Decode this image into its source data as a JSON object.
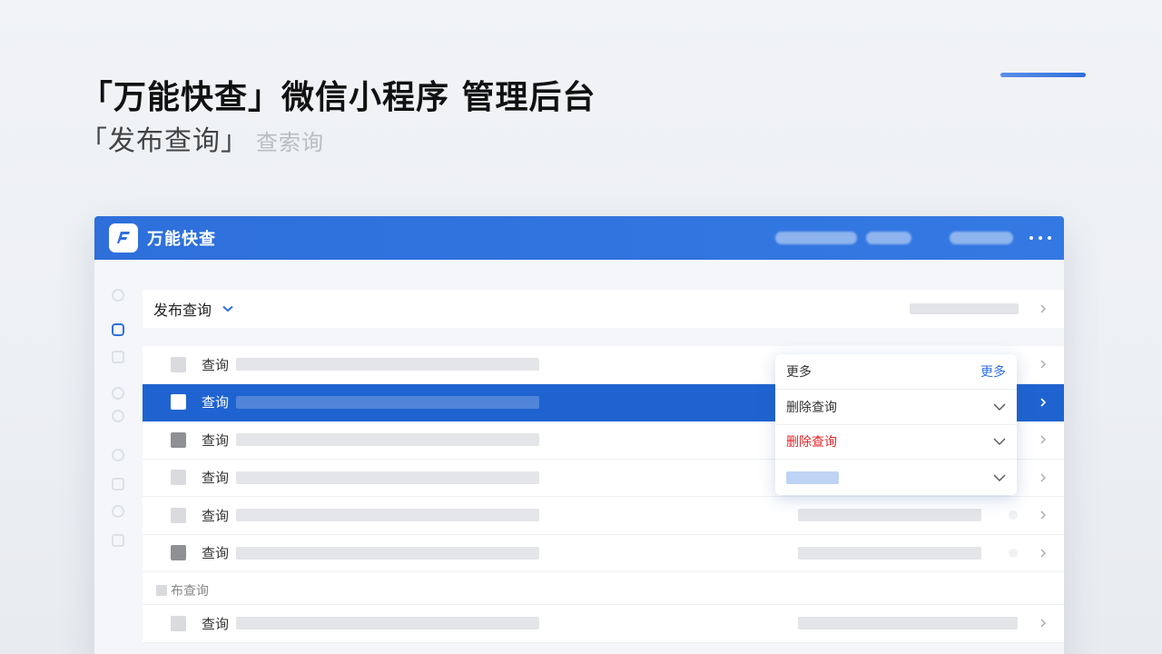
{
  "page": {
    "title": "「万能快查」微信小程序 管理后台",
    "subtitle": "「发布查询」",
    "subtitle_faded": "查索询"
  },
  "app": {
    "name": "万能快查",
    "header_color": "#2e6fdb"
  },
  "selector": {
    "label": "发布查询"
  },
  "list": {
    "rows": [
      {
        "label": "查询",
        "selected": false,
        "check": "light"
      },
      {
        "label": "查询",
        "selected": true,
        "check": "white"
      },
      {
        "label": "查询",
        "selected": false,
        "check": "dark"
      },
      {
        "label": "查询",
        "selected": false,
        "check": "light"
      },
      {
        "label": "查询",
        "selected": false,
        "check": "light"
      },
      {
        "label": "查询",
        "selected": false,
        "check": "dark"
      }
    ],
    "section_label": "布查询",
    "tail_row": {
      "label": "查询"
    }
  },
  "dropdown": {
    "items": [
      {
        "label": "更多",
        "link": "更多"
      },
      {
        "label": "删除查询"
      },
      {
        "label": "删除查询",
        "danger": true
      }
    ],
    "danger_color": "#e0242a",
    "accent_color": "#2f6fdd"
  }
}
